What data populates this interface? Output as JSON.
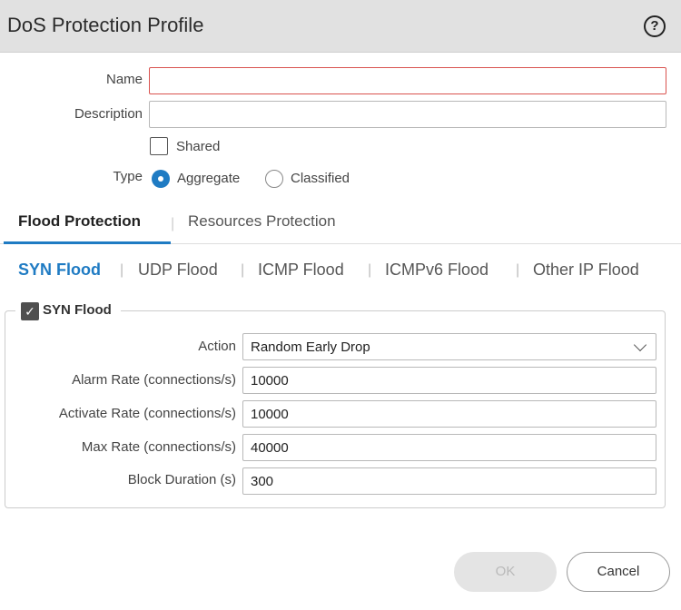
{
  "dialog": {
    "title": "DoS Protection Profile",
    "help_glyph": "?",
    "help_icon": "help-circle-icon"
  },
  "form": {
    "name_label": "Name",
    "name_value": "",
    "description_label": "Description",
    "description_value": "",
    "shared_label": "Shared",
    "shared_checked": false,
    "type_label": "Type",
    "type_options": [
      "Aggregate",
      "Classified"
    ],
    "type_selected": "Aggregate"
  },
  "tabs": [
    {
      "label": "Flood Protection",
      "active": true
    },
    {
      "label": "Resources Protection",
      "active": false
    }
  ],
  "subtabs": [
    {
      "label": "SYN Flood",
      "active": true
    },
    {
      "label": "UDP Flood",
      "active": false
    },
    {
      "label": "ICMP Flood",
      "active": false
    },
    {
      "label": "ICMPv6 Flood",
      "active": false
    },
    {
      "label": "Other IP Flood",
      "active": false
    }
  ],
  "syn_flood": {
    "enabled": true,
    "enabled_label": "SYN Flood",
    "check_glyph": "✓",
    "action_label": "Action",
    "action_value": "Random Early Drop",
    "alarm_rate_label": "Alarm Rate (connections/s)",
    "alarm_rate_value": "10000",
    "activate_rate_label": "Activate Rate (connections/s)",
    "activate_rate_value": "10000",
    "max_rate_label": "Max Rate (connections/s)",
    "max_rate_value": "40000",
    "block_duration_label": "Block Duration (s)",
    "block_duration_value": "300"
  },
  "buttons": {
    "ok_label": "OK",
    "ok_disabled": true,
    "cancel_label": "Cancel"
  },
  "colors": {
    "accent": "#1f7bc3",
    "error_border": "#d9534f",
    "titlebar_bg": "#e1e1e1"
  }
}
